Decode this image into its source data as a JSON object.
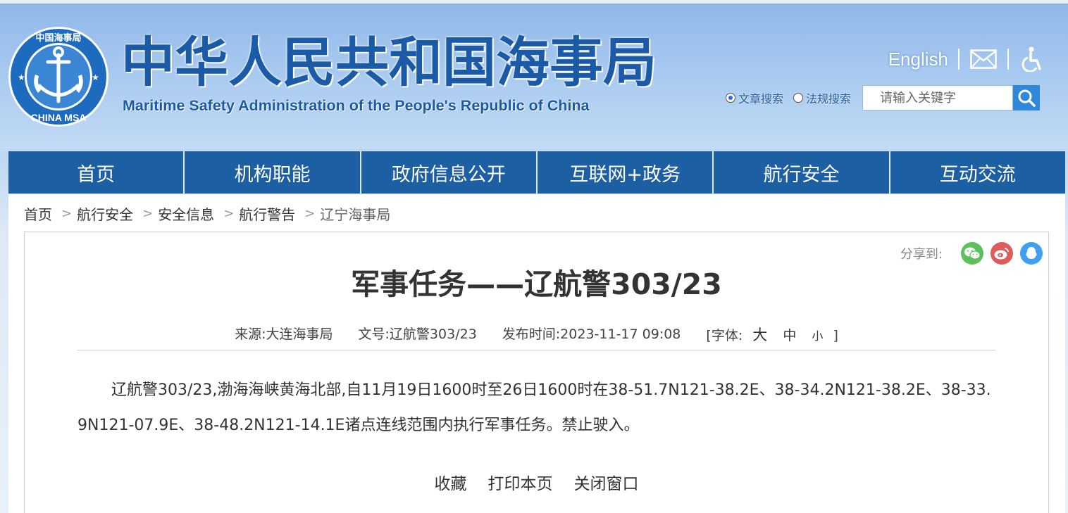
{
  "header": {
    "title_cn": "中华人民共和国海事局",
    "title_en": "Maritime Safety Administration of the People's Republic of China",
    "logo_text_top": "中国海事局",
    "logo_text_bottom": "CHINA MSA",
    "english_link": "English",
    "icons": [
      "mail-icon",
      "accessibility-icon"
    ]
  },
  "search": {
    "options": [
      {
        "label": "文章搜索",
        "checked": true
      },
      {
        "label": "法规搜索",
        "checked": false
      }
    ],
    "placeholder": "请输入关键字"
  },
  "nav": {
    "items": [
      "首页",
      "机构职能",
      "政府信息公开",
      "互联网+政务",
      "航行安全",
      "互动交流"
    ]
  },
  "breadcrumb": {
    "items": [
      "首页",
      "航行安全",
      "安全信息",
      "航行警告",
      "辽宁海事局"
    ],
    "separator": ">"
  },
  "share": {
    "label": "分享到:",
    "icons": [
      {
        "name": "wechat-icon",
        "color": "#5cc15c"
      },
      {
        "name": "weibo-icon",
        "color": "#e05b5b"
      },
      {
        "name": "qq-icon",
        "color": "#3ea1f0"
      }
    ]
  },
  "article": {
    "title": "军事任务——辽航警303/23",
    "source": "来源:大连海事局",
    "doc_no": "文号:辽航警303/23",
    "publish_time": "发布时间:2023-11-17 09:08",
    "font_label_open": "[字体:",
    "font_large": "大",
    "font_medium": "中",
    "font_small": "小",
    "font_label_close": "]",
    "body": "辽航警303/23,渤海海峡黄海北部,自11月19日1600时至26日1600时在38-51.7N121-38.2E、38-34.2N121-38.2E、38-33.9N121-07.9E、38-48.2N121-14.1E诸点连线范围内执行军事任务。禁止驶入。"
  },
  "actions": [
    "收藏",
    "打印本页",
    "关闭窗口"
  ]
}
